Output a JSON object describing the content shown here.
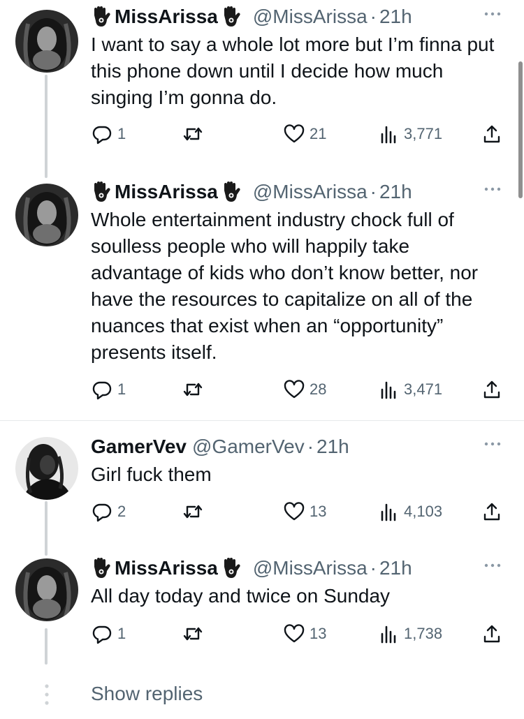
{
  "tweets": [
    {
      "display_name": "MissArissa",
      "handle": "@MissArissa",
      "separator": "·",
      "time": "21h",
      "text": "I want to say a whole lot more but I’m finna put this phone down until I decide how much singing I’m gonna do.",
      "replies": "1",
      "retweets": "",
      "likes": "21",
      "views": "3,771",
      "has_hamsa": true
    },
    {
      "display_name": "MissArissa",
      "handle": "@MissArissa",
      "separator": "·",
      "time": "21h",
      "text": "Whole entertainment industry chock full of soulless people who will happily take advantage of kids who don’t know better, nor have the resources to capitalize on all of the nuances that exist when an “opportunity” presents itself.",
      "replies": "1",
      "retweets": "",
      "likes": "28",
      "views": "3,471",
      "has_hamsa": true
    },
    {
      "display_name": "GamerVev",
      "handle": "@GamerVev",
      "separator": "·",
      "time": "21h",
      "text": "Girl fuck them",
      "replies": "2",
      "retweets": "",
      "likes": "13",
      "views": "4,103",
      "has_hamsa": false
    },
    {
      "display_name": "MissArissa",
      "handle": "@MissArissa",
      "separator": "·",
      "time": "21h",
      "text": "All day today and twice on Sunday",
      "replies": "1",
      "retweets": "",
      "likes": "13",
      "views": "1,738",
      "has_hamsa": true
    }
  ],
  "show_replies": "Show replies",
  "icons": {
    "reply": "reply-icon",
    "retweet": "retweet-icon",
    "like": "heart-icon",
    "views": "views-icon",
    "share": "share-icon",
    "more": "more-icon",
    "hamsa": "hamsa-icon"
  },
  "colors": {
    "text": "#0f1419",
    "secondary": "#536471",
    "thread_line": "#cfd3d6",
    "separator": "#e6e9ea"
  }
}
